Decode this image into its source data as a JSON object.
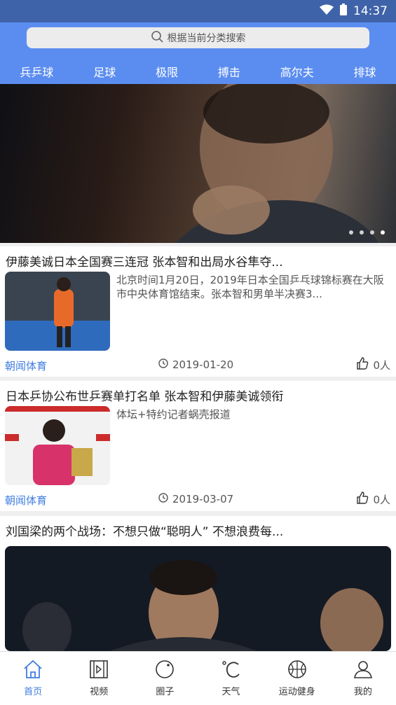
{
  "status_bar": {
    "time": "14:37"
  },
  "search": {
    "placeholder": "根据当前分类搜索"
  },
  "tabs": [
    {
      "label": "兵乒球",
      "active": true
    },
    {
      "label": "足球",
      "active": false
    },
    {
      "label": "极限",
      "active": false
    },
    {
      "label": "搏击",
      "active": false
    },
    {
      "label": "高尔夫",
      "active": false
    },
    {
      "label": "排球",
      "active": false
    }
  ],
  "banner": {
    "dot_count": 4,
    "active_index": 3
  },
  "articles": [
    {
      "title": "伊藤美诚日本全国赛三连冠 张本智和出局水谷隼夺...",
      "summary": "北京时间1月20日，2019年日本全国乒乓球锦标赛在大阪市中央体育馆结束。张本智和男单半决赛3...",
      "source": "朝闻体育",
      "date": "2019-01-20",
      "likes": "0人"
    },
    {
      "title": "日本乒协公布世乒赛单打名单 张本智和伊藤美诚领衔",
      "summary": "体坛+特约记者蜗壳报道",
      "source": "朝闻体育",
      "date": "2019-03-07",
      "likes": "0人"
    },
    {
      "title": "刘国梁的两个战场：不想只做“聪明人” 不想浪费每..."
    }
  ],
  "bottom_nav": [
    {
      "label": "首页",
      "icon": "home-icon",
      "active": true
    },
    {
      "label": "视频",
      "icon": "film-icon",
      "active": false
    },
    {
      "label": "圈子",
      "icon": "circle-icon",
      "active": false
    },
    {
      "label": "天气",
      "icon": "weather-icon",
      "active": false
    },
    {
      "label": "运动健身",
      "icon": "basketball-icon",
      "active": false
    },
    {
      "label": "我的",
      "icon": "user-icon",
      "active": false
    }
  ],
  "colors": {
    "header": "#5b8df0",
    "status": "#3f63a8",
    "accent": "#3f7de0"
  }
}
